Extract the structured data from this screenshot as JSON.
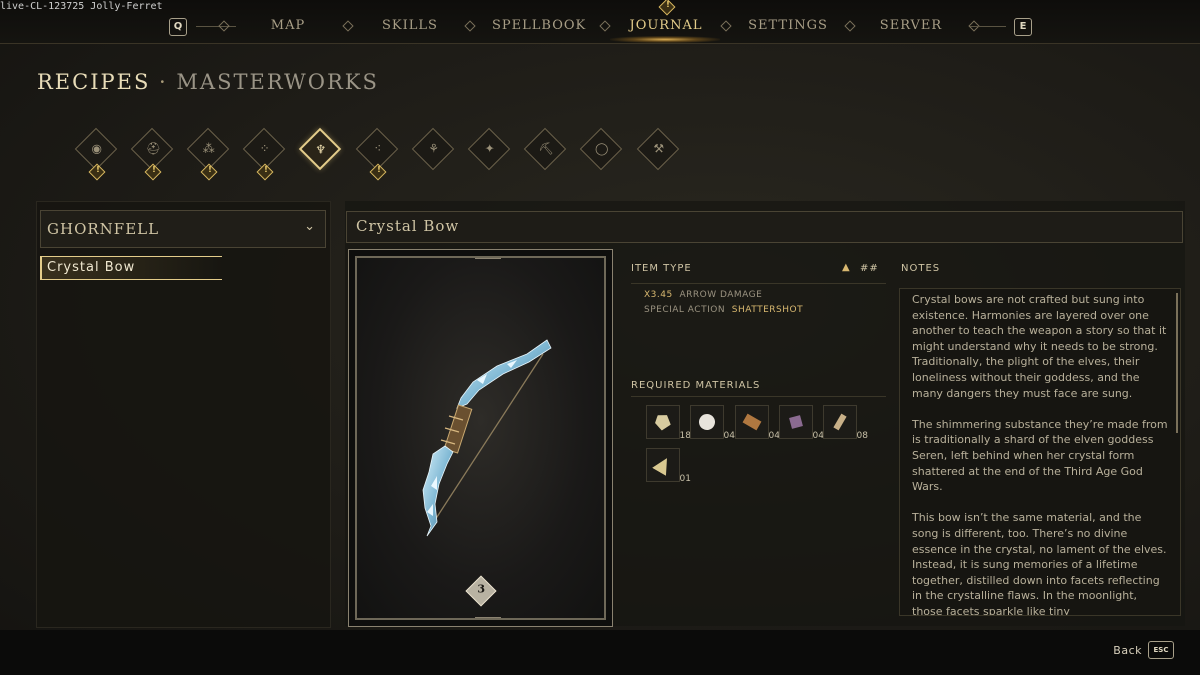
{
  "build_info": "live-CL-123725 Jolly-Ferret",
  "nav": {
    "left_key": "Q",
    "right_key": "E",
    "items": [
      {
        "label": "MAP",
        "active": false
      },
      {
        "label": "SKILLS",
        "active": false
      },
      {
        "label": "SPELLBOOK",
        "active": false
      },
      {
        "label": "JOURNAL",
        "active": true
      },
      {
        "label": "SETTINGS",
        "active": false
      },
      {
        "label": "SERVER",
        "active": false
      }
    ]
  },
  "header": {
    "title": "RECIPES",
    "separator": "·",
    "subtitle": "MASTERWORKS"
  },
  "categories": [
    {
      "icon": "eye-icon",
      "glyph": "◉",
      "badge": "!",
      "active": false
    },
    {
      "icon": "helmet-icon",
      "glyph": "⛑",
      "badge": "!",
      "active": false
    },
    {
      "icon": "ore-pile-icon",
      "glyph": "⁂",
      "badge": "!",
      "active": false
    },
    {
      "icon": "gems-icon",
      "glyph": "⁘",
      "badge": "!",
      "active": false
    },
    {
      "icon": "arrowhead-icon",
      "glyph": "♆",
      "badge": "",
      "active": true
    },
    {
      "icon": "rubble-icon",
      "glyph": "⁖",
      "badge": "!",
      "active": false
    },
    {
      "icon": "tree-icon",
      "glyph": "⚘",
      "badge": "",
      "active": false
    },
    {
      "icon": "sparkle-icon",
      "glyph": "✦",
      "badge": "",
      "active": false
    },
    {
      "icon": "pickaxe-icon",
      "glyph": "⛏",
      "badge": "",
      "active": false
    },
    {
      "icon": "ring-icon",
      "glyph": "◯",
      "badge": "",
      "active": false
    },
    {
      "icon": "axe-icon",
      "glyph": "⚒",
      "badge": "",
      "active": false
    }
  ],
  "sidebar": {
    "region": "GHORNFELL",
    "chevron": "⌄",
    "items": [
      {
        "label": "Crystal Bow",
        "selected": true
      }
    ]
  },
  "item": {
    "name": "Crystal Bow",
    "tier": "3",
    "type_label": "ITEM TYPE",
    "type_value": "##",
    "stats": [
      {
        "value": "X3.45",
        "text": "ARROW DAMAGE"
      },
      {
        "value": "SHATTERSHOT",
        "text": "SPECIAL ACTION"
      }
    ],
    "materials_label": "REQUIRED MATERIALS",
    "materials": [
      {
        "icon": "crystal-shard-icon",
        "count": "18",
        "color": "#d8cca0"
      },
      {
        "icon": "pearl-icon",
        "count": "04",
        "color": "#e8e4dc"
      },
      {
        "icon": "wood-plank-icon",
        "count": "04",
        "color": "#b07840"
      },
      {
        "icon": "amethyst-icon",
        "count": "04",
        "color": "#8a6a90"
      },
      {
        "icon": "feather-icon",
        "count": "08",
        "color": "#c8b088"
      },
      {
        "icon": "crystal-fragment-icon",
        "count": "01",
        "color": "#d8c890"
      }
    ],
    "notes_label": "NOTES",
    "notes": [
      "Crystal bows are not crafted but sung into existence. Harmonies are layered over one another to teach the weapon a story so that it might understand why it needs to be strong. Traditionally, the plight of the elves, their loneliness without their goddess, and the many dangers they must face are sung.",
      "The shimmering substance they’re made from is traditionally a shard of the elven goddess Seren, left behind when her crystal form shattered at the end of the Third Age God Wars.",
      "This bow isn’t the same material, and the song is different, too. There’s no divine essence in the crystal, no lament of the elves. Instead, it is sung memories of a lifetime together, distilled down into facets reflecting in the crystalline flaws. In the moonlight, those facets sparkle like tiny"
    ]
  },
  "footer": {
    "back_label": "Back",
    "back_key": "ESC"
  },
  "colors": {
    "accent": "#e3cc8a",
    "background": "#1d1b16",
    "crystal": "#8ec4dc"
  }
}
